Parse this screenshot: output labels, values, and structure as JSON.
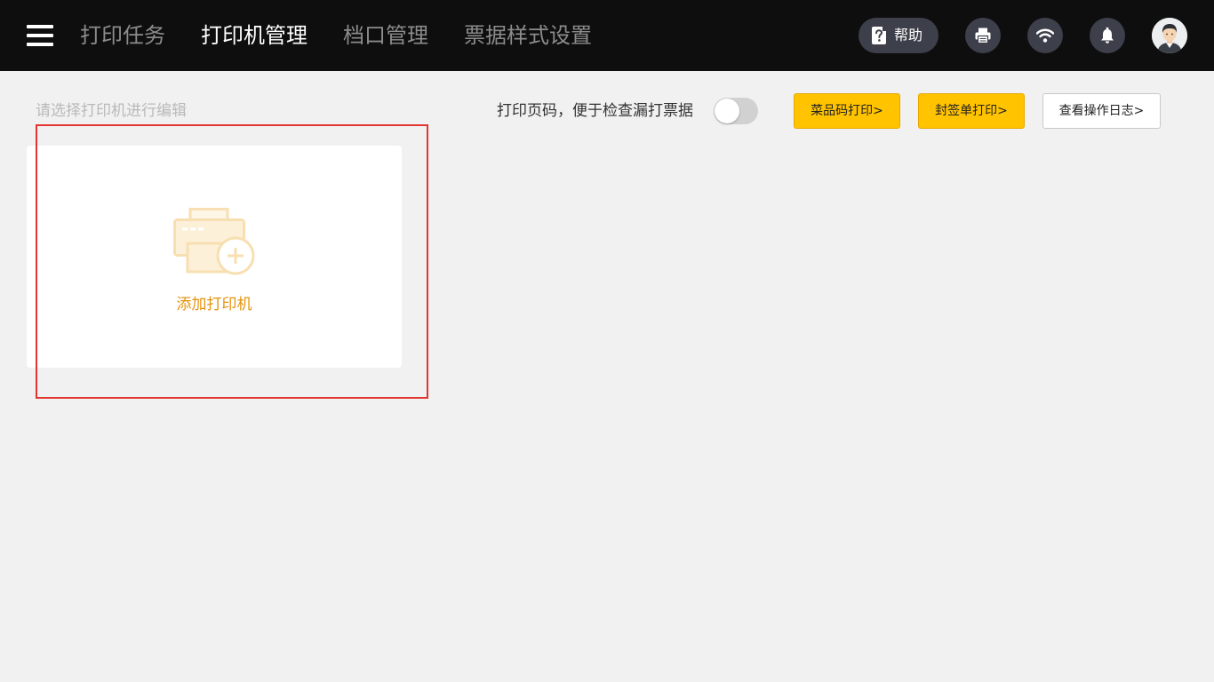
{
  "header": {
    "tabs": [
      {
        "label": "打印任务",
        "active": false
      },
      {
        "label": "打印机管理",
        "active": true
      },
      {
        "label": "档口管理",
        "active": false
      },
      {
        "label": "票据样式设置",
        "active": false
      }
    ],
    "help_label": "帮助",
    "icons": [
      "menu-icon",
      "help-icon",
      "printer-icon",
      "wifi-icon",
      "bell-icon",
      "avatar"
    ]
  },
  "toolbar": {
    "hint": "请选择打印机进行编辑",
    "pager_label": "打印页码，便于检查漏打票据",
    "pager_toggle_on": false,
    "dish_code_print": "菜品码打印>",
    "seal_print": "封签单打印>",
    "view_log": "查看操作日志>"
  },
  "card": {
    "add_label": "添加打印机"
  },
  "colors": {
    "topbar_bg": "#0e0e0e",
    "icon_button_bg": "#3d3f4a",
    "accent_yellow": "#ffc300",
    "add_text": "#e6930e",
    "highlight_border": "#e23530",
    "page_bg": "#f1f1f1"
  }
}
